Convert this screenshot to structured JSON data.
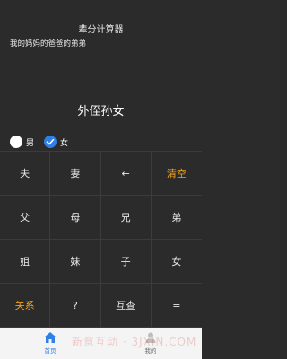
{
  "app": {
    "title": "辈分计算器"
  },
  "display": {
    "expression": "我的妈妈的爸爸的弟弟",
    "result": "外侄孙女"
  },
  "gender": {
    "male_label": "男",
    "female_label": "女",
    "selected": "女"
  },
  "keys": [
    {
      "label": "夫"
    },
    {
      "label": "妻"
    },
    {
      "label": "←"
    },
    {
      "label": "清空"
    },
    {
      "label": "父"
    },
    {
      "label": "母"
    },
    {
      "label": "兄"
    },
    {
      "label": "弟"
    },
    {
      "label": "姐"
    },
    {
      "label": "妹"
    },
    {
      "label": "子"
    },
    {
      "label": "女"
    },
    {
      "label": "关系"
    },
    {
      "label": "?"
    },
    {
      "label": "互查"
    },
    {
      "label": "="
    }
  ],
  "tabbar": {
    "home_label": "首页",
    "me_label": "我的"
  },
  "colors": {
    "accent": "#f0a020",
    "primary": "#2f7fe6",
    "background": "#2b2b2b"
  },
  "watermark": "新意互动 · 3JXIN.COM"
}
